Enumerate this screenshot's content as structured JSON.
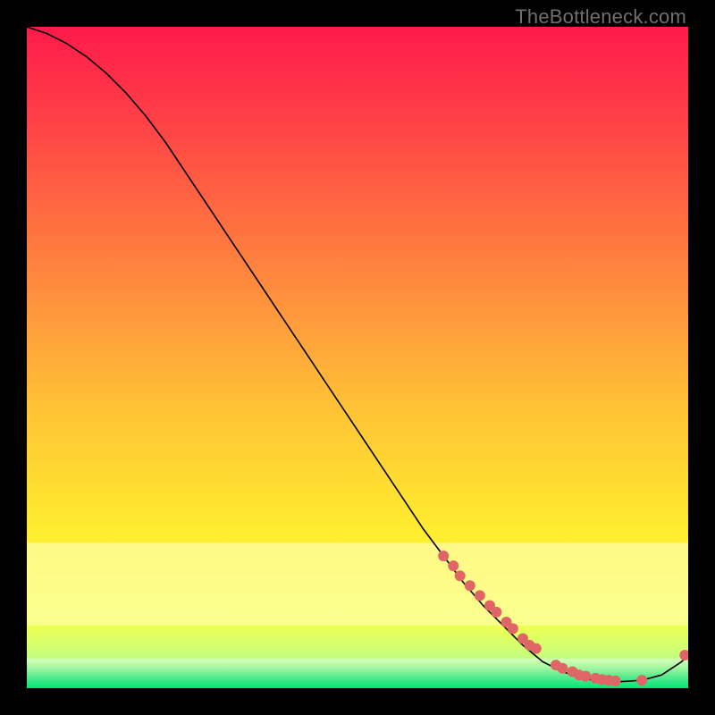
{
  "watermark": "TheBottleneck.com",
  "chart_data": {
    "type": "line",
    "title": "",
    "xlabel": "",
    "ylabel": "",
    "xlim": [
      0,
      100
    ],
    "ylim": [
      0,
      100
    ],
    "grid": false,
    "legend": false,
    "background_gradient_top": "#ff1a4b",
    "background_gradient_mid_upper": "#ff8b3e",
    "background_gradient_mid": "#ffd531",
    "background_gradient_mid_lower": "#ffff33",
    "background_gradient_lower": "#e6ff66",
    "background_gradient_bottom": "#00e673",
    "series": [
      {
        "name": "curve",
        "type": "line",
        "color": "#000000",
        "x": [
          0,
          3,
          6,
          9,
          12,
          15,
          18,
          21,
          24,
          27,
          30,
          33,
          36,
          39,
          42,
          45,
          48,
          51,
          54,
          57,
          60,
          63,
          66,
          69,
          72,
          75,
          78,
          81,
          84,
          87,
          90,
          93,
          96,
          99,
          100
        ],
        "y": [
          100,
          99,
          97.5,
          95.5,
          93,
          90,
          86.5,
          82.5,
          78,
          73.5,
          69,
          64.5,
          60,
          55.5,
          51,
          46.5,
          42,
          37.5,
          33,
          28.5,
          24,
          20,
          16,
          12.5,
          9.5,
          6.5,
          4,
          2.5,
          1.5,
          1,
          1,
          1.2,
          2,
          4,
          5
        ]
      },
      {
        "name": "dots",
        "type": "scatter",
        "color": "#e06666",
        "radius": 6,
        "x": [
          63,
          64.5,
          65.5,
          67,
          68.5,
          70,
          71,
          72.5,
          73.5,
          75,
          76,
          77,
          80,
          81,
          82.5,
          83.5,
          84.5,
          86,
          87,
          88,
          89,
          93,
          99.5
        ],
        "y": [
          20,
          18.5,
          17,
          15.5,
          14,
          12.5,
          11.5,
          10,
          9,
          7.5,
          6.5,
          6,
          3.5,
          3,
          2.5,
          2,
          1.8,
          1.5,
          1.3,
          1.2,
          1.1,
          1.2,
          5
        ]
      }
    ],
    "bands": [
      {
        "name": "pale-yellow-band",
        "y_top": 22,
        "y_bottom": 9.5,
        "color_top": "#ffffcc",
        "color_bottom": "#faffc0"
      },
      {
        "name": "green-band",
        "y_top": 4.5,
        "y_bottom": 0,
        "color_top": "#d1ffb3",
        "color_bottom": "#00e673"
      }
    ]
  }
}
